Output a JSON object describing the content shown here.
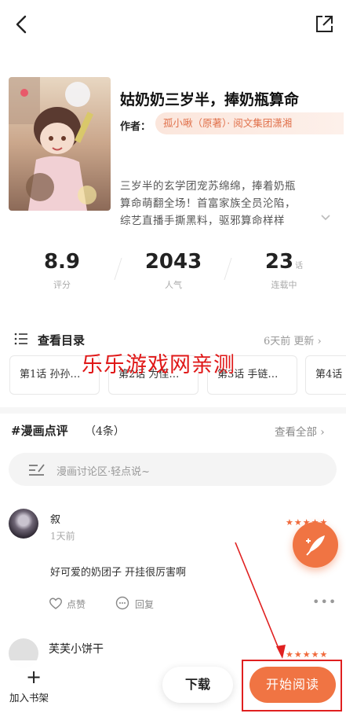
{
  "nav": {
    "back_icon": "chevron-left-icon",
    "share_icon": "share-icon"
  },
  "book": {
    "title": "姑奶奶三岁半，捧奶瓶算命",
    "author_label": "作者：",
    "authors": "孤小啾（原著）· 阅文集团潇湘",
    "synopsis_lines": [
      "三岁半的玄学团宠苏绵绵，捧着奶瓶",
      "算命萌翻全场！首富家族全员沦陷，",
      "综艺直播手撕黑料，驱邪算命样样"
    ]
  },
  "stats": [
    {
      "value": "8.9",
      "label": "评分",
      "suffix": ""
    },
    {
      "value": "2043",
      "label": "人气",
      "suffix": ""
    },
    {
      "value": "23",
      "label": "连载中",
      "suffix": "话"
    }
  ],
  "catalog": {
    "title": "查看目录",
    "update": "6天前 更新",
    "chapters": [
      "第1话 孙孙…",
      "第2话 为侄…",
      "第3话 手链…",
      "第4话"
    ]
  },
  "watermark": "乐乐游戏网亲测",
  "reviews": {
    "title": "#漫画点评",
    "count": "（4条）",
    "view_all": "查看全部",
    "placeholder": "漫画讨论区·轻点说~",
    "items": [
      {
        "user": "叙",
        "time": "1天前",
        "text": "好可爱的奶团子 开挂很厉害啊",
        "stars": "★★★★★",
        "like": "点赞",
        "reply": "回复"
      },
      {
        "user": "芙芙小饼干",
        "stars": "★★★★★"
      }
    ]
  },
  "bottom": {
    "add_shelf": "加入书架",
    "download": "下载",
    "read": "开始阅读"
  },
  "colors": {
    "accent": "#f07443",
    "annotation": "#e01818"
  }
}
